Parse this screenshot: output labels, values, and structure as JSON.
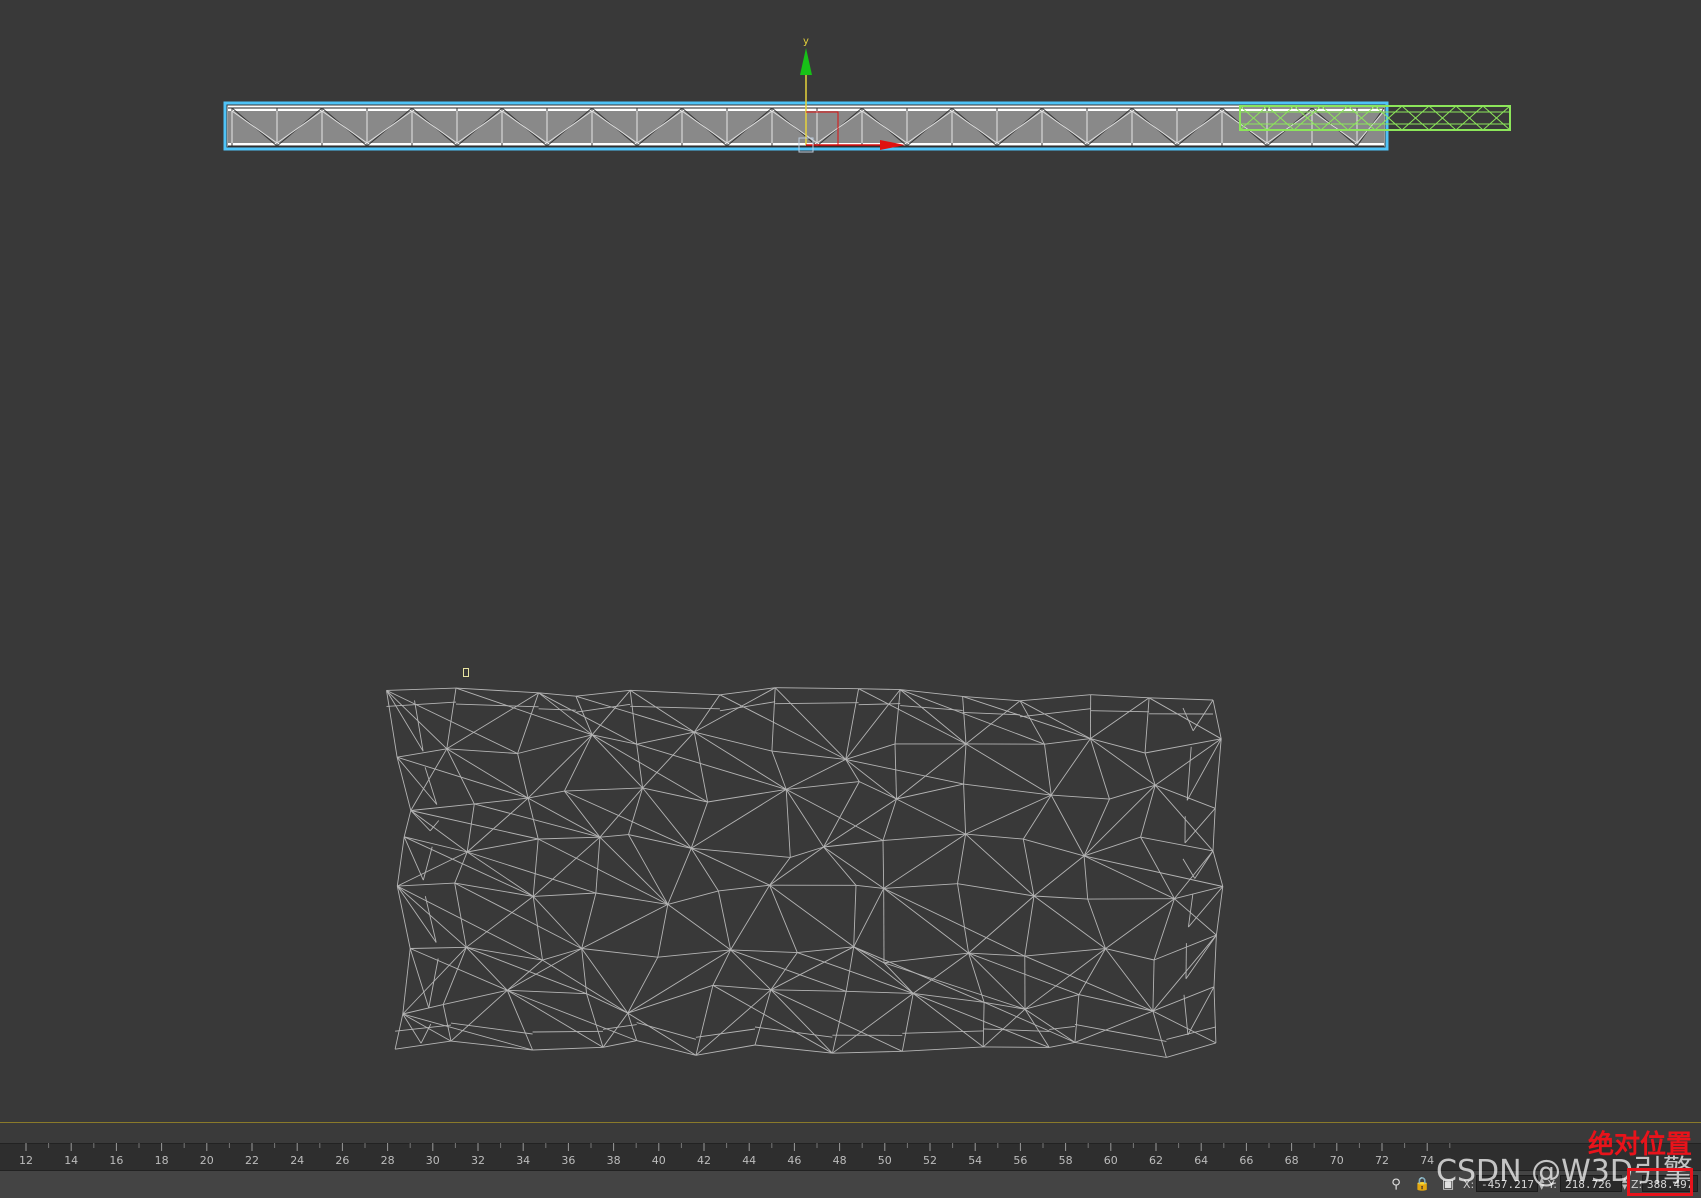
{
  "viewport": {
    "gizmo_axis_label": "y",
    "colors": {
      "background": "#393939",
      "selection_outline": "#4fc3f7",
      "secondary_selection": "#8ce65a",
      "wireframe": "#b4b4b4",
      "gizmo_y": "#17c117",
      "gizmo_x": "#e01010",
      "gizmo_z_line": "#e6d23a"
    }
  },
  "timeline": {
    "ticks": [
      "12",
      "14",
      "16",
      "18",
      "20",
      "22",
      "24",
      "26",
      "28",
      "30",
      "32",
      "34",
      "36",
      "38",
      "40",
      "42",
      "44",
      "46",
      "48",
      "50",
      "52",
      "54",
      "56",
      "58",
      "60",
      "62",
      "64",
      "66",
      "68",
      "70",
      "72",
      "74"
    ]
  },
  "statusbar": {
    "icons": [
      "lightbulb-icon",
      "lock-icon",
      "absolute-mode-icon"
    ],
    "x_label": "X:",
    "x_value": "-457.217",
    "y_label": "Y:",
    "y_value": "218.726",
    "z_label": "Z:",
    "z_value": "388.497"
  },
  "overlay": {
    "watermark": "CSDN @W3D引擎",
    "annotation": "绝对位置"
  }
}
